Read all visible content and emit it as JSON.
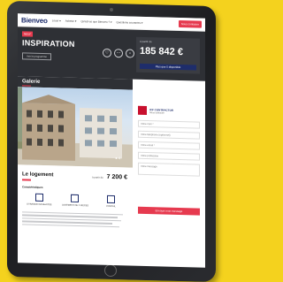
{
  "header": {
    "logo": "Bienveo",
    "nav": [
      "Louer ▾",
      "Acheter ▾",
      "Qu'est-ce que Bienveo ? ▾",
      "Questions courantes ▾"
    ],
    "cta": "Nous contacter"
  },
  "band": {
    "badge": "NEUF",
    "title": "INSPIRATION",
    "subtitle": "",
    "small_button": "Voir le programme",
    "price_card": {
      "label": "A partir de",
      "price": "185 842",
      "unit": "€",
      "sub": "",
      "button": "Plus que 5 disponible"
    }
  },
  "galerie": {
    "title": "Galerie",
    "photo_count": "4"
  },
  "logement": {
    "title": "Le logement",
    "price_prefix": "à partir de",
    "price": "7 200 €",
    "carac_title": "Caractéristiques",
    "features": [
      {
        "icon": "calendar-icon",
        "label": "LIVRAISON SOUHAITÉE"
      },
      {
        "icon": "layers-icon",
        "label": "LOGEMENT DE 2 PIÈCES"
      },
      {
        "icon": "building-icon",
        "label": "PORTAIL"
      }
    ]
  },
  "contact": {
    "title": "ICF CONTRACTOR",
    "subtitle": "Nous contacter",
    "fields": [
      "Votre nom *",
      "Votre téléphone (optionnel)",
      "Votre email *",
      "Votre profession",
      "Votre message"
    ],
    "send": "Envoyer mon message",
    "note": ""
  }
}
